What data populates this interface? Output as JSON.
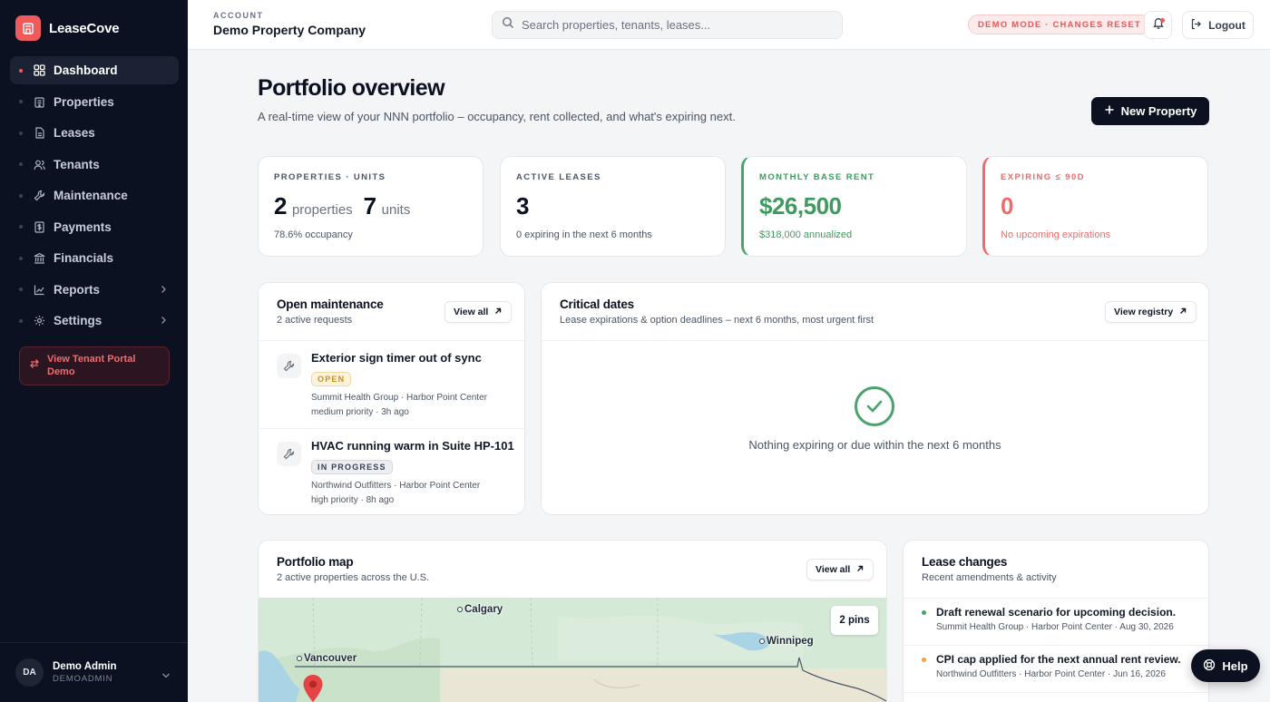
{
  "brand": {
    "name": "LeaseCove"
  },
  "sidebar": {
    "items": [
      {
        "label": "Dashboard",
        "icon": "dashboard-icon",
        "active": true
      },
      {
        "label": "Properties",
        "icon": "building-icon"
      },
      {
        "label": "Leases",
        "icon": "document-icon"
      },
      {
        "label": "Tenants",
        "icon": "users-icon"
      },
      {
        "label": "Maintenance",
        "icon": "wrench-icon"
      },
      {
        "label": "Payments",
        "icon": "dollar-icon"
      },
      {
        "label": "Financials",
        "icon": "bank-icon"
      },
      {
        "label": "Reports",
        "icon": "chart-icon",
        "has_submenu": true
      },
      {
        "label": "Settings",
        "icon": "gear-icon",
        "has_submenu": true
      }
    ],
    "tenant_portal_label": "View Tenant Portal Demo",
    "user": {
      "initials": "DA",
      "name": "Demo Admin",
      "handle": "DEMOADMIN"
    }
  },
  "topbar": {
    "account_label": "ACCOUNT",
    "account_name": "Demo Property Company",
    "search_placeholder": "Search properties, tenants, leases...",
    "demo_badge": "DEMO MODE · CHANGES RESET",
    "logout_label": "Logout"
  },
  "page": {
    "title": "Portfolio overview",
    "subtitle": "A real-time view of your NNN portfolio – occupancy, rent collected, and what's expiring next.",
    "new_property_label": "New Property"
  },
  "stats": {
    "properties": {
      "label": "PROPERTIES · UNITS",
      "count": "2",
      "count_unit": "properties",
      "units": "7",
      "units_unit": "units",
      "note": "78.6% occupancy"
    },
    "leases": {
      "label": "ACTIVE LEASES",
      "value": "3",
      "note": "0 expiring in the next 6 months"
    },
    "rent": {
      "label": "MONTHLY BASE RENT",
      "value": "$26,500",
      "note": "$318,000 annualized",
      "color": "#3f9a5f"
    },
    "expiring": {
      "label": "EXPIRING ≤ 90D",
      "value": "0",
      "note": "No upcoming expirations",
      "color": "#ef6b6b"
    }
  },
  "maintenance": {
    "title": "Open maintenance",
    "subtitle": "2 active requests",
    "view_all_label": "View all",
    "items": [
      {
        "title": "Exterior sign timer out of sync",
        "status": "OPEN",
        "meta1": "Summit Health Group · Harbor Point Center",
        "meta2": "medium priority · 3h ago"
      },
      {
        "title": "HVAC running warm in Suite HP-101",
        "status": "IN PROGRESS",
        "meta1": "Northwind Outfitters · Harbor Point Center",
        "meta2": "high priority · 8h ago"
      }
    ]
  },
  "critical_dates": {
    "title": "Critical dates",
    "subtitle": "Lease expirations & option deadlines – next 6 months, most urgent first",
    "view_registry_label": "View registry",
    "empty_text": "Nothing expiring or due within the next 6 months"
  },
  "portfolio_map": {
    "title": "Portfolio map",
    "subtitle": "2 active properties across the U.S.",
    "view_all_label": "View all",
    "pins_label": "2 pins",
    "cities": [
      "Calgary",
      "Vancouver",
      "Winnipeg"
    ]
  },
  "lease_changes": {
    "title": "Lease changes",
    "subtitle": "Recent amendments & activity",
    "items": [
      {
        "title": "Draft renewal scenario for upcoming decision.",
        "meta": "Summit Health Group · Harbor Point Center · Aug 30, 2026",
        "dot_color": "#4aa36a"
      },
      {
        "title": "CPI cap applied for the next annual rent review.",
        "meta": "Northwind Outfitters · Harbor Point Center · Jun 16, 2026",
        "dot_color": "#f0a04b"
      }
    ]
  },
  "help": {
    "label": "Help"
  }
}
